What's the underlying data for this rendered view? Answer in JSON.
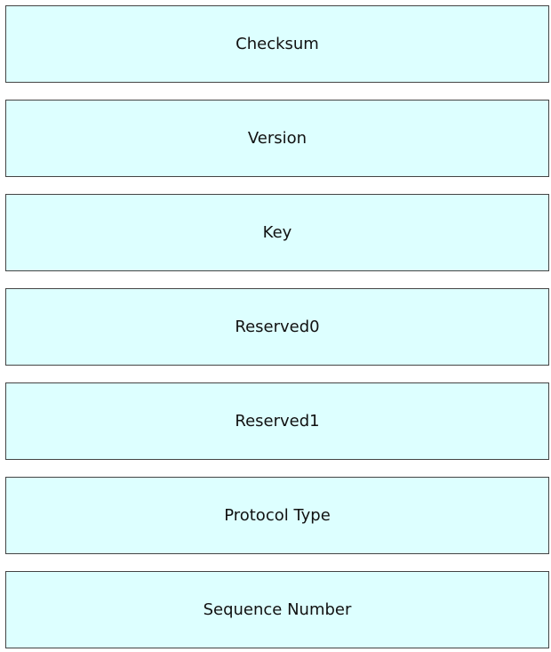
{
  "colors": {
    "box_fill": "#ddffff",
    "box_border": "#444444",
    "text": "#111111"
  },
  "fields": [
    {
      "label": "Checksum"
    },
    {
      "label": "Version"
    },
    {
      "label": "Key"
    },
    {
      "label": "Reserved0"
    },
    {
      "label": "Reserved1"
    },
    {
      "label": "Protocol Type"
    },
    {
      "label": "Sequence Number"
    }
  ]
}
